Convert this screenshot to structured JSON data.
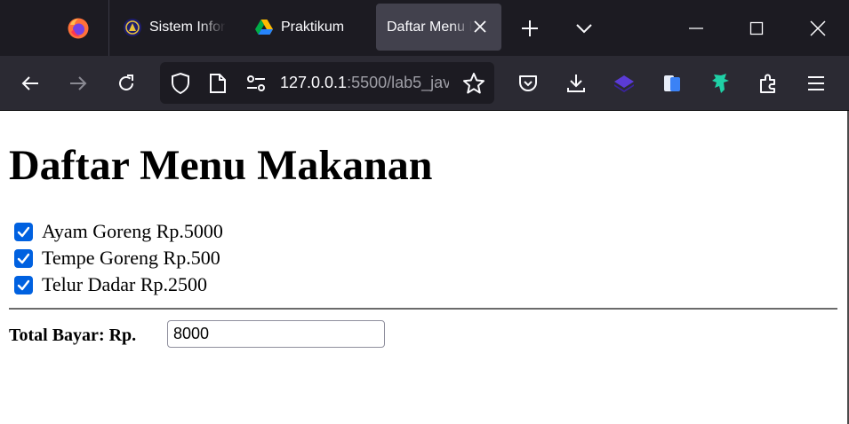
{
  "browser": {
    "tabs": [
      {
        "label": "Sistem Informasi",
        "active": false,
        "favicon": "university-logo-icon"
      },
      {
        "label": "Praktikum",
        "active": false,
        "favicon": "google-drive-icon"
      },
      {
        "label": "Daftar Menu Makanan",
        "active": true
      }
    ],
    "url": {
      "host": "127.0.0.1",
      "rest": ":5500/lab5_jav"
    },
    "colors": {
      "tabstrip": "#1c1b22",
      "toolbar": "#2b2a33",
      "active_tab": "#42414d"
    }
  },
  "page": {
    "title": "Daftar Menu Makanan",
    "items": [
      {
        "label": "Ayam Goreng Rp.5000",
        "checked": true
      },
      {
        "label": "Tempe Goreng Rp.500",
        "checked": true
      },
      {
        "label": "Telur Dadar Rp.2500",
        "checked": true
      }
    ],
    "total_label": "Total Bayar: Rp.",
    "total_value": "8000",
    "accent": "#0061e0"
  }
}
